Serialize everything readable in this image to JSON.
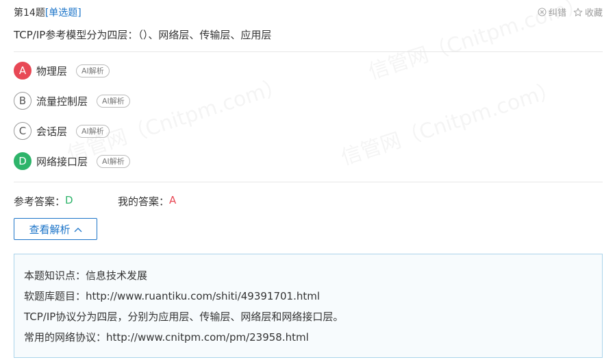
{
  "header": {
    "question_number": "第14题",
    "question_type": "[单选题]",
    "report_label": "纠错",
    "favorite_label": "收藏"
  },
  "question": {
    "stem": "TCP/IP参考模型分为四层：（）、网络层、传输层、应用层"
  },
  "options": [
    {
      "letter": "A",
      "text": "物理层",
      "ai_label": "AI解析",
      "state": "wrong"
    },
    {
      "letter": "B",
      "text": "流量控制层",
      "ai_label": "AI解析",
      "state": "normal"
    },
    {
      "letter": "C",
      "text": "会话层",
      "ai_label": "AI解析",
      "state": "normal"
    },
    {
      "letter": "D",
      "text": "网络接口层",
      "ai_label": "AI解析",
      "state": "correct"
    }
  ],
  "answers": {
    "reference_label": "参考答案：",
    "reference_value": "D",
    "mine_label": "我的答案：",
    "mine_value": "A"
  },
  "analysis_toggle": {
    "label": "查看解析"
  },
  "analysis": {
    "lines": [
      "本题知识点：信息技术发展",
      "软题库题目：http://www.ruantiku.com/shiti/49391701.html",
      "TCP/IP协议分为四层，分别为应用层、传输层、网络层和网络接口层。",
      "常用的网络协议：http://www.cnitpm.com/pm/23958.html"
    ]
  },
  "watermark": {
    "text": "信管网（Cnitpm.com）"
  },
  "colors": {
    "link_blue": "#1a73c8",
    "correct_green": "#2eb46a",
    "wrong_red": "#e84855",
    "analysis_border": "#a9d3ea",
    "analysis_bg": "#f7fbfd"
  }
}
